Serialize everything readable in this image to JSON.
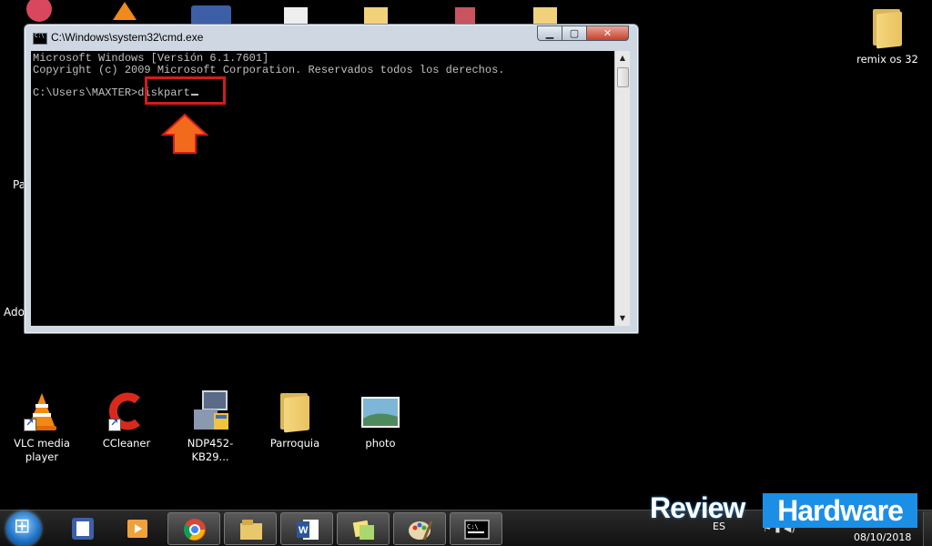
{
  "window": {
    "title": "C:\\Windows\\system32\\cmd.exe",
    "buttons": {
      "minimize": "▁",
      "maximize": "▢",
      "close": "✕"
    },
    "console_lines": [
      "Microsoft Windows [Versión 6.1.7601]",
      "Copyright (c) 2009 Microsoft Corporation. Reservados todos los derechos.",
      ""
    ],
    "prompt": "C:\\Users\\MAXTER>",
    "command": "diskpart"
  },
  "desktop": {
    "icons": [
      {
        "label": "VLC media player"
      },
      {
        "label": "CCleaner"
      },
      {
        "label": "NDP452-KB29..."
      },
      {
        "label": "Parroquia"
      },
      {
        "label": "photo"
      },
      {
        "label": "remix os 32"
      }
    ],
    "partial_labels": {
      "left1": "Pa",
      "left2": "Ado"
    }
  },
  "taskbar": {
    "items": [
      "start-button",
      "desktop-app",
      "media-player",
      "chrome",
      "file-explorer",
      "word",
      "sticky-notes",
      "paint",
      "cmd"
    ],
    "language": "ES",
    "date": "08/10/2018"
  },
  "watermark": {
    "part1": "Review",
    "part2": "Hardware"
  },
  "colors": {
    "highlight": "#d11c1c",
    "arrow": "#f26a1b",
    "console_bg": "#000000",
    "console_text": "#c0c0c0",
    "watermark_blue": "#1b8fe6"
  },
  "icons": [
    "cmd-icon",
    "vlc-icon",
    "ccleaner-icon",
    "installer-icon",
    "folder-icon",
    "photo-icon",
    "chrome-icon",
    "word-icon",
    "paint-icon",
    "windows-logo-icon"
  ]
}
